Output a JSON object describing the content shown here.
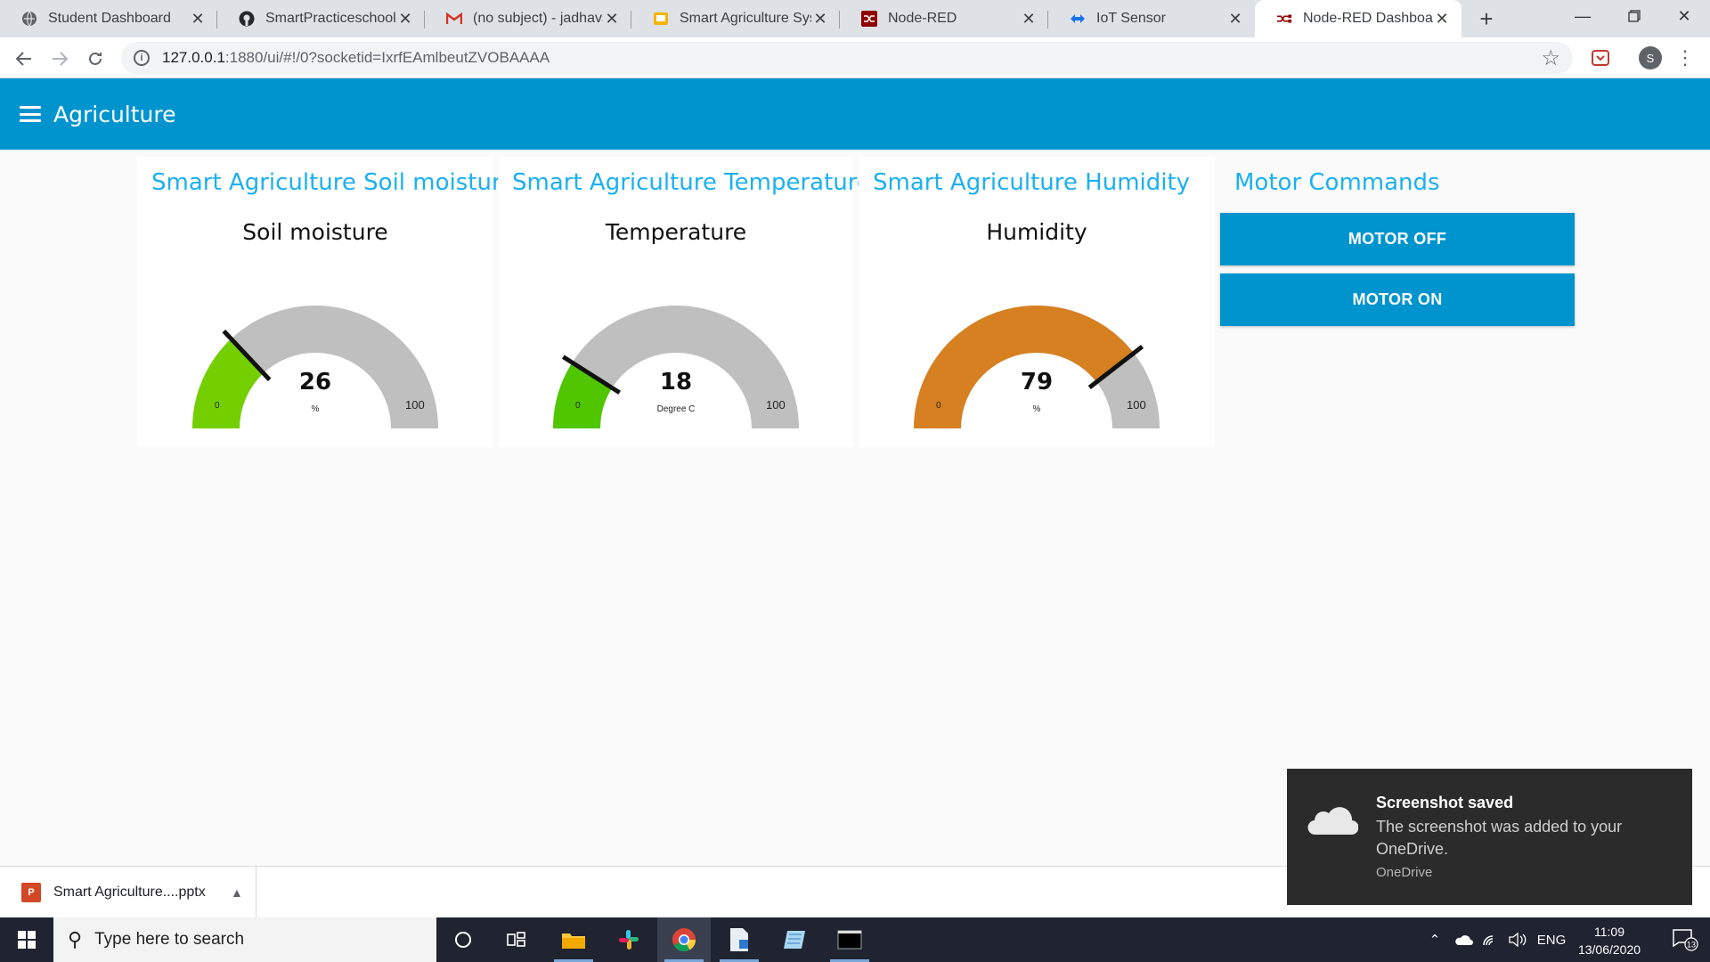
{
  "browser": {
    "tabs": [
      {
        "title": "Student Dashboard",
        "icon": "globe-icon"
      },
      {
        "title": "SmartPracticeschool/IIS",
        "icon": "github-icon"
      },
      {
        "title": "(no subject) - jadhavsa",
        "icon": "gmail-icon"
      },
      {
        "title": "Smart Agriculture Syste",
        "icon": "slides-icon"
      },
      {
        "title": "Node-RED",
        "icon": "nodered-icon"
      },
      {
        "title": "IoT Sensor",
        "icon": "iot-icon"
      },
      {
        "title": "Node-RED Dashboard",
        "icon": "nodered-dashboard-icon",
        "active": true
      }
    ],
    "url_host": "127.0.0.1",
    "url_path": ":1880/ui/#!/0?socketid=IxrfEAmlbeutZVOBAAAA",
    "profile_initial": "S"
  },
  "app": {
    "title": "Agriculture"
  },
  "gauges": [
    {
      "group_title": "Smart Agriculture Soil moisture",
      "label": "Soil moisture",
      "value": 26,
      "display": "26",
      "unit": "%",
      "min": 0,
      "max": 100,
      "min_label": "0",
      "max_label": "100",
      "color": "#74cf00"
    },
    {
      "group_title": "Smart Agriculture Temperature",
      "label": "Temperature",
      "value": 18,
      "display": "18",
      "unit": "Degree C",
      "min": 0,
      "max": 100,
      "min_label": "0",
      "max_label": "100",
      "color": "#4fc600"
    },
    {
      "group_title": "Smart Agriculture Humidity",
      "label": "Humidity",
      "value": 79,
      "display": "79",
      "unit": "%",
      "min": 0,
      "max": 100,
      "min_label": "0",
      "max_label": "100",
      "color": "#d68021"
    }
  ],
  "motor": {
    "title": "Motor Commands",
    "off_label": "MOTOR OFF",
    "on_label": "MOTOR ON"
  },
  "downloads": {
    "file_name": "Smart Agriculture....pptx"
  },
  "toast": {
    "title": "Screenshot saved",
    "body": "The screenshot was added to your OneDrive.",
    "source": "OneDrive"
  },
  "taskbar": {
    "search_placeholder": "Type here to search",
    "language": "ENG",
    "time": "11:09",
    "date": "13/06/2020",
    "notification_count": "13"
  },
  "colors": {
    "accent": "#0094ce",
    "group_title": "#1bb0f0",
    "gauge_track": "#bfbfbf"
  }
}
